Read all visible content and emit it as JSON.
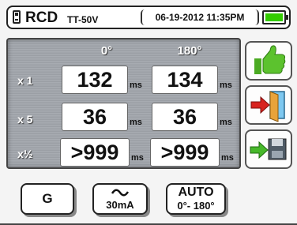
{
  "header": {
    "title": "RCD",
    "model": "TT-50V",
    "datetime": "06-19-2012 11:35PM",
    "battery_level": 1.0,
    "battery_color": "#33cc00"
  },
  "table": {
    "col_headers": [
      "0°",
      "180°"
    ],
    "rows": [
      {
        "label": "x 1",
        "values": [
          "132",
          "134"
        ],
        "units": [
          "ms",
          "ms"
        ]
      },
      {
        "label": "x 5",
        "values": [
          "36",
          "36"
        ],
        "units": [
          "ms",
          "ms"
        ]
      },
      {
        "label": "x½",
        "values": [
          ">999",
          ">999"
        ],
        "units": [
          "ms",
          "ms"
        ]
      }
    ]
  },
  "side_buttons": [
    {
      "icon": "thumbs-up-icon"
    },
    {
      "icon": "exit-door-icon"
    },
    {
      "icon": "save-icon"
    }
  ],
  "bottom_buttons": {
    "mode_label": "G",
    "current_label": "30mA",
    "current_icon": "ac-wave-icon",
    "phase_line1": "AUTO",
    "phase_line2": "0°- 180°"
  }
}
